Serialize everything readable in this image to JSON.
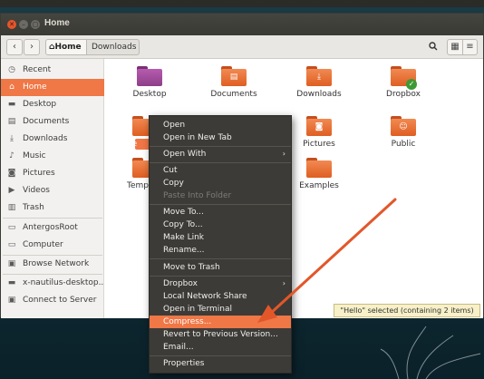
{
  "window": {
    "title": "Home"
  },
  "toolbar": {
    "breadcrumbs": [
      {
        "label": "Home"
      },
      {
        "label": "Downloads"
      }
    ]
  },
  "sidebar": {
    "items": [
      {
        "label": "Recent",
        "icon": "clock-icon"
      },
      {
        "label": "Home",
        "icon": "home-icon"
      },
      {
        "label": "Desktop",
        "icon": "folder-icon"
      },
      {
        "label": "Documents",
        "icon": "document-icon"
      },
      {
        "label": "Downloads",
        "icon": "download-icon"
      },
      {
        "label": "Music",
        "icon": "music-icon"
      },
      {
        "label": "Pictures",
        "icon": "camera-icon"
      },
      {
        "label": "Videos",
        "icon": "video-icon"
      },
      {
        "label": "Trash",
        "icon": "trash-icon"
      },
      {
        "label": "AntergosRoot",
        "icon": "drive-icon"
      },
      {
        "label": "Computer",
        "icon": "drive-icon"
      },
      {
        "label": "Browse Network",
        "icon": "network-icon"
      },
      {
        "label": "x-nautilus-desktop...",
        "icon": "folder-icon"
      },
      {
        "label": "Connect to Server",
        "icon": "server-icon"
      }
    ],
    "active_index": 1
  },
  "folders": [
    {
      "label": "Desktop"
    },
    {
      "label": "Documents"
    },
    {
      "label": "Downloads"
    },
    {
      "label": "Dropbox"
    },
    {
      "label": "He"
    },
    {
      "label": "Pictures"
    },
    {
      "label": "Public"
    },
    {
      "label": "Temp"
    },
    {
      "label": "Examples"
    }
  ],
  "status": {
    "text": "\"Hello\" selected  (containing 2 items)"
  },
  "context_menu": {
    "items": [
      {
        "label": "Open"
      },
      {
        "label": "Open in New Tab"
      },
      {
        "label": "Open With"
      },
      {
        "label": "Cut"
      },
      {
        "label": "Copy"
      },
      {
        "label": "Paste Into Folder"
      },
      {
        "label": "Move To..."
      },
      {
        "label": "Copy To..."
      },
      {
        "label": "Make Link"
      },
      {
        "label": "Rename..."
      },
      {
        "label": "Move to Trash"
      },
      {
        "label": "Dropbox"
      },
      {
        "label": "Local Network Share"
      },
      {
        "label": "Open in Terminal"
      },
      {
        "label": "Compress..."
      },
      {
        "label": "Revert to Previous Version..."
      },
      {
        "label": "Email..."
      },
      {
        "label": "Properties"
      }
    ]
  },
  "colors": {
    "accent": "#f07746",
    "menu_bg": "#3c3b37",
    "annotation_arrow": "#e2572a"
  }
}
